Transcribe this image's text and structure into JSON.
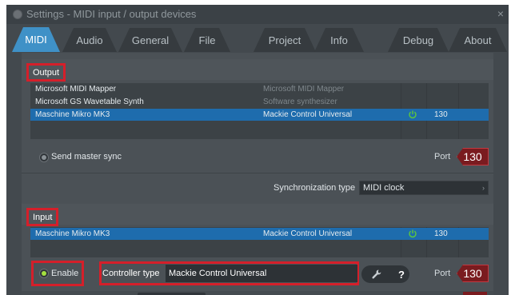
{
  "window": {
    "title": "Settings - MIDI input / output devices",
    "close_glyph": "×",
    "icon": "fl-studio-logo-icon"
  },
  "tabs": [
    {
      "label": "MIDI",
      "active": true
    },
    {
      "label": "Audio",
      "active": false
    },
    {
      "label": "General",
      "active": false
    },
    {
      "label": "File",
      "active": false
    },
    {
      "label": "Project",
      "active": false
    },
    {
      "label": "Info",
      "active": false
    },
    {
      "label": "Debug",
      "active": false
    },
    {
      "label": "About",
      "active": false
    }
  ],
  "output": {
    "section_label": "Output",
    "rows": [
      {
        "name": "Microsoft MIDI Mapper",
        "controller": "Microsoft MIDI Mapper",
        "selected": false,
        "enabled": false,
        "port": ""
      },
      {
        "name": "Microsoft GS Wavetable Synth",
        "controller": "Software synthesizer",
        "selected": false,
        "enabled": false,
        "port": ""
      },
      {
        "name": "Maschine Mikro MK3",
        "controller": "Mackie Control Universal",
        "selected": true,
        "enabled": true,
        "port": "130"
      }
    ],
    "send_master_sync_label": "Send master sync",
    "send_master_sync_checked": false,
    "port_label": "Port",
    "port_value": "130",
    "sync_type_label": "Synchronization type",
    "sync_type_value": "MIDI clock"
  },
  "input": {
    "section_label": "Input",
    "rows": [
      {
        "name": "Maschine Mikro MK3",
        "controller": "Mackie Control Universal",
        "selected": true,
        "enabled": true,
        "port": "130"
      }
    ],
    "enable_label": "Enable",
    "enable_checked": true,
    "controller_type_label": "Controller type",
    "controller_type_value": "Mackie Control Universal",
    "help_glyph": "?",
    "port_label": "Port",
    "port_value": "130"
  },
  "colors": {
    "accent": "#3f91c7",
    "selection": "#1e6cad",
    "highlight_box": "#d51f2a",
    "port_fill": "#7a1b1f",
    "enabled_green": "#a4e03f",
    "power_green": "#5ec83a"
  },
  "icons": {
    "power": "power-icon",
    "wrench": "wrench-icon",
    "help": "help-icon",
    "dropdown": "chevron-right-icon"
  }
}
